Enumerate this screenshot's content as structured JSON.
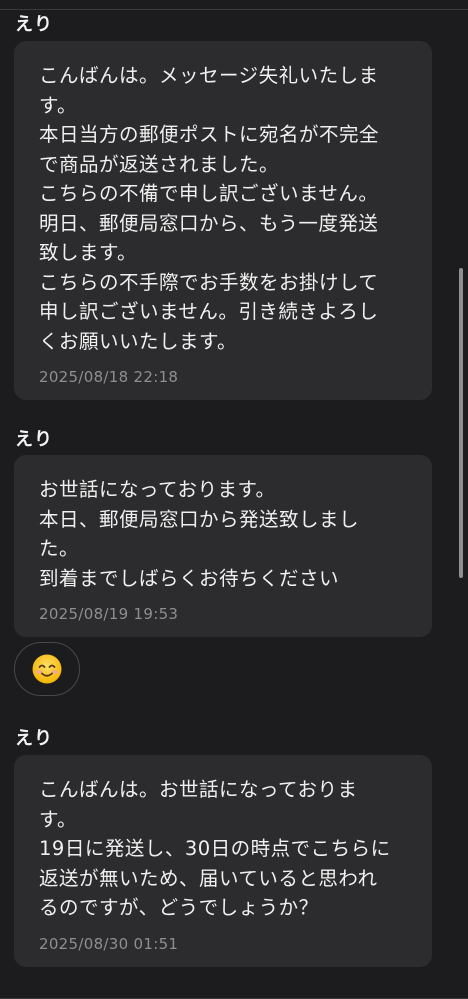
{
  "messages": [
    {
      "sender": "えり",
      "lines": [
        "こんばんは。メッセージ失礼いたしま",
        "す。",
        "本日当方の郵便ポストに宛名が不完全",
        "で商品が返送されました。",
        "こちらの不備で申し訳ございません。",
        "明日、郵便局窓口から、もう一度発送",
        "致します。",
        "こちらの不手際でお手数をお掛けして",
        "申し訳ございません。引き続きよろし",
        "くお願いいたします。"
      ],
      "timestamp": "2025/08/18 22:18"
    },
    {
      "sender": "えり",
      "lines": [
        "お世話になっております。",
        "本日、郵便局窓口から発送致しまし",
        "た。",
        "到着までしばらくお待ちください"
      ],
      "timestamp": "2025/08/19 19:53",
      "reaction_icon": "smiling-face-icon"
    },
    {
      "sender": "えり",
      "lines": [
        "こんばんは。お世話になっておりま",
        "す。",
        "19日に発送し、30日の時点でこちらに",
        "返送が無いため、届いていると思われ",
        "るのですが、どうでしょうか？"
      ],
      "timestamp": "2025/08/30 01:51"
    }
  ],
  "colors": {
    "background": "#1c1c1e",
    "bubble": "#2c2c2e",
    "text": "#f0f0f0",
    "timestamp": "#8e8e93",
    "emoji": "#f7c948"
  }
}
